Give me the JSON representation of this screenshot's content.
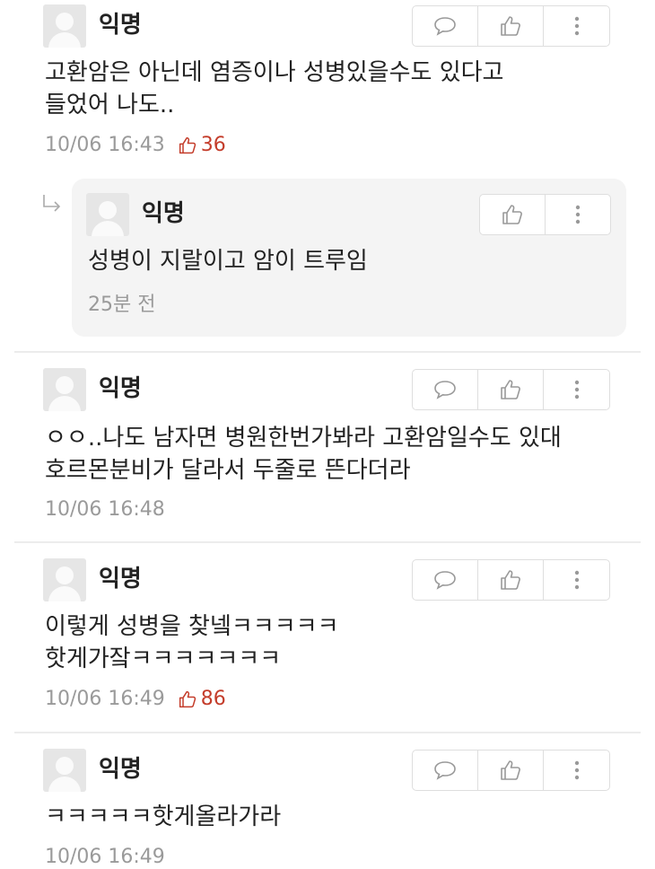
{
  "comments": [
    {
      "author": "익명",
      "text": "고환암은 아닌데 염증이나 성병있을수도 있다고\n들었어 나도..",
      "time": "10/06 16:43",
      "likes": "36"
    },
    {
      "author": "익명",
      "text": "ㅇㅇ..나도 남자면 병원한번가봐라 고환암일수도 있대\n호르몬분비가 달라서 두줄로 뜬다더라",
      "time": "10/06 16:48"
    },
    {
      "author": "익명",
      "text": "이렇게 성병을 찾넼ㅋㅋㅋㅋㅋ\n핫게가잨ㅋㅋㅋㅋㅋㅋㅋ",
      "time": "10/06 16:49",
      "likes": "86"
    },
    {
      "author": "익명",
      "text": "ㅋㅋㅋㅋㅋ핫게올라가라",
      "time": "10/06 16:49"
    }
  ],
  "reply": {
    "author": "익명",
    "text": "성병이 지랄이고 암이 트루임",
    "time": "25분 전"
  },
  "icons": {
    "comment": "comment-bubble-icon",
    "like": "thumbs-up-icon",
    "more": "more-vertical-icon",
    "reply": "reply-arrow-icon"
  },
  "colors": {
    "like": "#c43d2b",
    "meta": "#9a9a9a",
    "reply_bg": "#f4f4f4"
  }
}
